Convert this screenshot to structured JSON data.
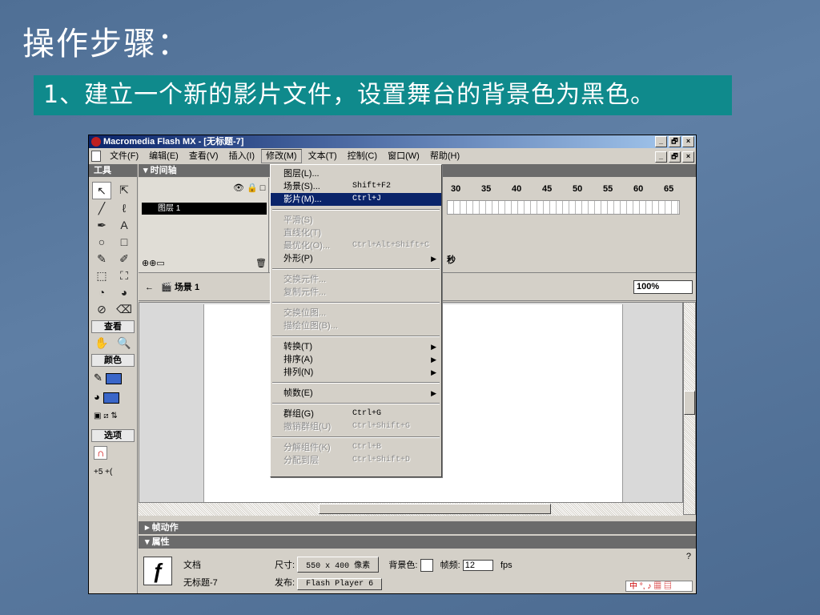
{
  "slide": {
    "title": "操作步骤：",
    "subtitle": "1、建立一个新的影片文件，设置舞台的背景色为黑色。"
  },
  "window": {
    "title": "Macromedia Flash MX - [无标题-7]",
    "buttons": [
      "_",
      "🗗",
      "×"
    ]
  },
  "menubar": {
    "items": [
      "文件(F)",
      "编辑(E)",
      "查看(V)",
      "插入(I)",
      "修改(M)",
      "文本(T)",
      "控制(C)",
      "窗口(W)",
      "帮助(H)"
    ]
  },
  "toolbox": {
    "title": "工具",
    "sections": {
      "view": "查看",
      "colors": "颜色",
      "options": "选项"
    },
    "tools": [
      "↖",
      "⇱",
      "╱",
      "ℓ",
      "✒",
      "A",
      "○",
      "□",
      "✎",
      "✐",
      "⬚",
      "⛶",
      "◔",
      "◕",
      "⊘",
      "⌫"
    ],
    "view_tools": [
      "✋",
      "🔍"
    ]
  },
  "timeline": {
    "title": "时间轴",
    "layer_name": "图层 1",
    "ruler": [
      "30",
      "35",
      "40",
      "45",
      "50",
      "55",
      "60",
      "65"
    ],
    "sec_suffix": "秒"
  },
  "scene": {
    "name": "场景 1",
    "zoom": "100%"
  },
  "panels": {
    "actions": "帧动作",
    "properties": "属性"
  },
  "properties": {
    "type_label": "文档",
    "doc_name": "无标题-7",
    "size_label": "尺寸:",
    "size_value": "550 x 400 像素",
    "bg_label": "背景色:",
    "fps_label": "帧频:",
    "fps_value": "12",
    "fps_unit": "fps",
    "publish_label": "发布:",
    "publish_value": "Flash Player 6"
  },
  "dropdown": {
    "items": [
      {
        "label": "图层(L)...",
        "shortcut": "",
        "arrow": false,
        "disabled": false,
        "hl": false
      },
      {
        "label": "场景(S)...",
        "shortcut": "Shift+F2",
        "arrow": false,
        "disabled": false,
        "hl": false
      },
      {
        "label": "影片(M)...",
        "shortcut": "Ctrl+J",
        "arrow": false,
        "disabled": false,
        "hl": true
      },
      {
        "sep": true
      },
      {
        "label": "平滑(S)",
        "shortcut": "",
        "arrow": false,
        "disabled": true,
        "hl": false
      },
      {
        "label": "直线化(T)",
        "shortcut": "",
        "arrow": false,
        "disabled": true,
        "hl": false
      },
      {
        "label": "最优化(O)...",
        "shortcut": "Ctrl+Alt+Shift+C",
        "arrow": false,
        "disabled": true,
        "hl": false
      },
      {
        "label": "外形(P)",
        "shortcut": "",
        "arrow": true,
        "disabled": false,
        "hl": false
      },
      {
        "sep": true
      },
      {
        "label": "交换元件...",
        "shortcut": "",
        "arrow": false,
        "disabled": true,
        "hl": false
      },
      {
        "label": "复制元件...",
        "shortcut": "",
        "arrow": false,
        "disabled": true,
        "hl": false
      },
      {
        "sep": true
      },
      {
        "label": "交换位图...",
        "shortcut": "",
        "arrow": false,
        "disabled": true,
        "hl": false
      },
      {
        "label": "描绘位图(B)...",
        "shortcut": "",
        "arrow": false,
        "disabled": true,
        "hl": false
      },
      {
        "sep": true
      },
      {
        "label": "转换(T)",
        "shortcut": "",
        "arrow": true,
        "disabled": false,
        "hl": false
      },
      {
        "label": "排序(A)",
        "shortcut": "",
        "arrow": true,
        "disabled": false,
        "hl": false
      },
      {
        "label": "排列(N)",
        "shortcut": "",
        "arrow": true,
        "disabled": false,
        "hl": false
      },
      {
        "sep": true
      },
      {
        "label": "帧数(E)",
        "shortcut": "",
        "arrow": true,
        "disabled": false,
        "hl": false
      },
      {
        "sep": true
      },
      {
        "label": "群组(G)",
        "shortcut": "Ctrl+G",
        "arrow": false,
        "disabled": false,
        "hl": false
      },
      {
        "label": "撤销群组(U)",
        "shortcut": "Ctrl+Shift+G",
        "arrow": false,
        "disabled": true,
        "hl": false
      },
      {
        "sep": true
      },
      {
        "label": "分解组件(K)",
        "shortcut": "Ctrl+B",
        "arrow": false,
        "disabled": true,
        "hl": false
      },
      {
        "label": "分配到层",
        "shortcut": "Ctrl+Shift+D",
        "arrow": false,
        "disabled": true,
        "hl": false
      }
    ]
  },
  "colors": {
    "slide_bg": "#5a7aa0",
    "subtitle_bg": "#0f8a8c",
    "highlight": "#0a246a"
  }
}
